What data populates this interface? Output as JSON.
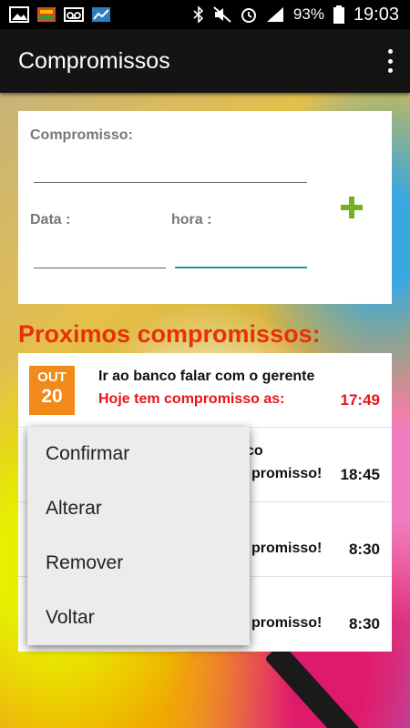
{
  "status_bar": {
    "battery": "93%",
    "time": "19:03",
    "left_icons": [
      "image-icon",
      "app-icon",
      "voicemail-icon",
      "chart-icon"
    ],
    "right_icons": [
      "bluetooth-icon",
      "mute-icon",
      "alarm-icon",
      "signal-icon",
      "battery-icon"
    ]
  },
  "app_bar": {
    "title": "Compromissos"
  },
  "form": {
    "compromisso_label": "Compromisso:",
    "compromisso_value": "",
    "data_label": "Data :",
    "data_value": "",
    "hora_label": "hora :",
    "hora_value": ""
  },
  "list_title": "Proximos compromissos:",
  "appointments": [
    {
      "month": "OUT",
      "day": "20",
      "title": "Ir ao banco falar com o gerente",
      "subtitle": "Hoje tem compromisso as:",
      "time": "17:49"
    },
    {
      "title": "co",
      "subtitle": "promisso!",
      "time": "18:45"
    },
    {
      "title": "",
      "subtitle": "promisso!",
      "time": "8:30"
    },
    {
      "title": "",
      "subtitle": "promisso!",
      "time": "8:30"
    }
  ],
  "context_menu": {
    "items": [
      "Confirmar",
      "Alterar",
      "Remover",
      "Voltar"
    ]
  },
  "colors": {
    "accent_red": "#e8300a",
    "date_orange": "#f28a1a",
    "add_green": "#6fb41f",
    "focus_teal": "#1f9c8c"
  }
}
